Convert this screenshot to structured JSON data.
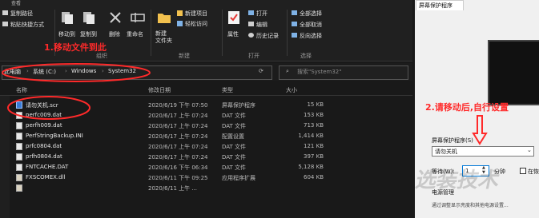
{
  "titlebar": {
    "title": "查看"
  },
  "ribbon": {
    "copy_path": "复制路径",
    "paste_shortcut": "粘贴快捷方式",
    "move_to": "移动到",
    "copy_to": "复制到",
    "delete": "删除",
    "rename": "重命名",
    "new_folder": "新建\n文件夹",
    "new_item": "新建项目",
    "easy_access": "轻松访问",
    "properties": "属性",
    "open": "打开",
    "edit": "编辑",
    "history": "历史记录",
    "select_all": "全部选择",
    "select_none": "全部取消",
    "invert_selection": "反向选择",
    "group_organize": "组织",
    "group_new": "新建",
    "group_open": "打开",
    "group_select": "选择"
  },
  "address": {
    "path": [
      "此电脑",
      "系统 (C:)",
      "Windows",
      "System32"
    ],
    "search_placeholder": "搜索\"System32\""
  },
  "columns": {
    "name": "名称",
    "date": "修改日期",
    "type": "类型",
    "size": "大小"
  },
  "files": [
    {
      "name": "请勿关机.scr",
      "date": "2020/6/19 下午 07:50",
      "type": "屏幕保护程序",
      "size": "15 KB"
    },
    {
      "name": "perfc009.dat",
      "date": "2020/6/17 上午 07:24",
      "type": "DAT 文件",
      "size": "153 KB"
    },
    {
      "name": "perfh009.dat",
      "date": "2020/6/17 上午 07:24",
      "type": "DAT 文件",
      "size": "713 KB"
    },
    {
      "name": "PerfStringBackup.INI",
      "date": "2020/6/17 上午 07:24",
      "type": "配置设置",
      "size": "1,414 KB"
    },
    {
      "name": "prfc0804.dat",
      "date": "2020/6/17 上午 07:24",
      "type": "DAT 文件",
      "size": "121 KB"
    },
    {
      "name": "prfh0804.dat",
      "date": "2020/6/17 上午 07:24",
      "type": "DAT 文件",
      "size": "397 KB"
    },
    {
      "name": "FNTCACHE.DAT",
      "date": "2020/6/16 下午 06:34",
      "type": "DAT 文件",
      "size": "5,128 KB"
    },
    {
      "name": "FXSCOMEX.dll",
      "date": "2020/6/11 下午 09:25",
      "type": "应用程序扩展",
      "size": "604 KB"
    },
    {
      "name": "",
      "date": "2020/6/11 上午 ...",
      "type": "",
      "size": ""
    }
  ],
  "annotations": {
    "step1": "1.移动文件到此",
    "step2": "2.请移动后,自行设置"
  },
  "dialog": {
    "tab": "屏幕保护程序",
    "group_label": "屏幕保护程序(S)",
    "selected_saver": "请勿关机",
    "wait_label": "等待(W):",
    "wait_value": "1",
    "minutes": "分钟",
    "resume_label": "在恢",
    "power_label": "电源管理",
    "power_desc": "通过调整显示亮度和其他电源设置..."
  },
  "watermark": "选装技术",
  "colors": {
    "annotation": "#ff2a2a",
    "accent": "#0078d7"
  }
}
